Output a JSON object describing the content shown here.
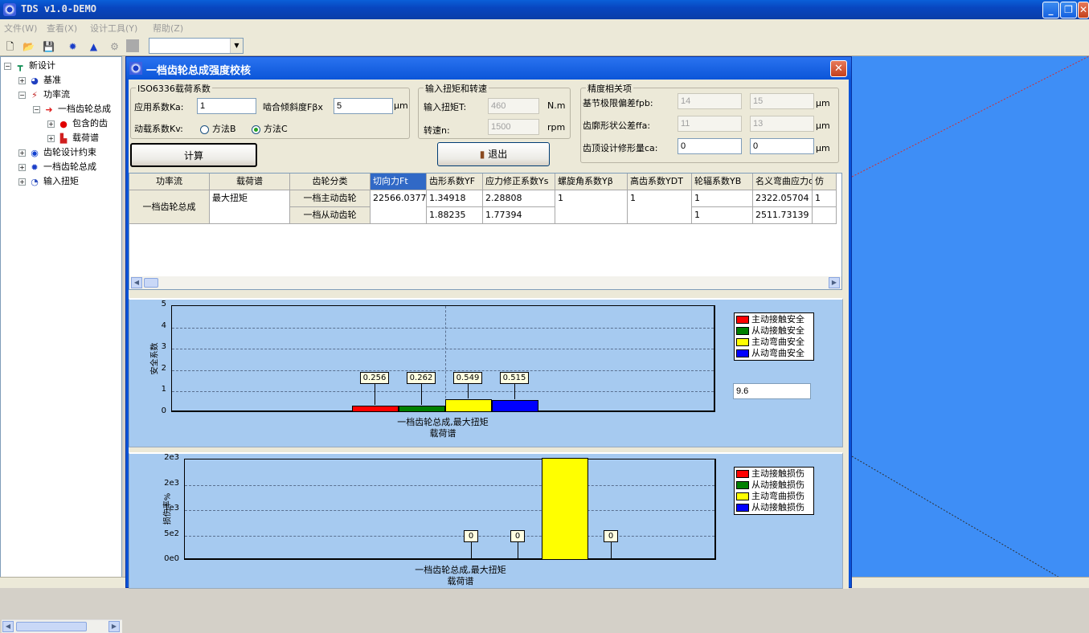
{
  "app": {
    "title": "TDS v1.0-DEMO"
  },
  "menu": [
    "文件(W)",
    "查看(X)",
    "设计工具(Y)",
    "帮助(Z)"
  ],
  "toolbar": {
    "combo_value": ""
  },
  "tree": {
    "items": [
      {
        "label": "新设计",
        "level": 0,
        "icon": "design-root-icon",
        "expander": "−"
      },
      {
        "label": "基准",
        "level": 1,
        "icon": "datum-icon",
        "expander": "+"
      },
      {
        "label": "功率流",
        "level": 1,
        "icon": "power-flow-icon",
        "expander": "−"
      },
      {
        "label": "一档齿轮总成",
        "level": 2,
        "icon": "arrow-red-icon",
        "expander": "−"
      },
      {
        "label": "包含的齿",
        "level": 3,
        "icon": "red-dot-icon",
        "expander": "+"
      },
      {
        "label": "载荷谱",
        "level": 3,
        "icon": "load-spectrum-icon",
        "expander": "+"
      },
      {
        "label": "齿轮设计约束",
        "level": 1,
        "icon": "constraint-icon",
        "expander": "+"
      },
      {
        "label": "一档齿轮总成",
        "level": 1,
        "icon": "gear-assembly-icon",
        "expander": "+"
      },
      {
        "label": "输入扭矩",
        "level": 1,
        "icon": "torque-icon",
        "expander": "+"
      }
    ]
  },
  "dialog": {
    "title": "一档齿轮总成强度校核",
    "iso": {
      "title": "ISO6336载荷系数",
      "ka_label": "应用系数Ka:",
      "ka_value": "1",
      "fbx_label": "啮合倾斜度Fβx",
      "fbx_value": "5",
      "fbx_unit": "μm",
      "kv_label": "动载系数Kv:",
      "method_b": "方法B",
      "method_c": "方法C",
      "selected": "C"
    },
    "torque": {
      "title": "输入扭矩和转速",
      "t_label": "输入扭矩T:",
      "t_value": "460",
      "t_unit": "N.m",
      "n_label": "转速n:",
      "n_value": "1500",
      "n_unit": "rpm"
    },
    "precision": {
      "title": "精度相关项",
      "fpb_label": "基节极限偏差fpb:",
      "fpb_1": "14",
      "fpb_2": "15",
      "fpb_unit": "μm",
      "ffa_label": "齿廓形状公差ffa:",
      "ffa_1": "11",
      "ffa_2": "13",
      "ffa_unit": "μm",
      "ca_label": "齿顶设计修形量ca:",
      "ca_1": "0",
      "ca_2": "0",
      "ca_unit": "μm"
    },
    "calc_button": "计算",
    "exit_button": "退出",
    "table": {
      "headers": [
        "功率流",
        "载荷谱",
        "齿轮分类",
        "切向力Ft",
        "齿形系数YF",
        "应力修正系数Ys",
        "螺旋角系数Yβ",
        "高齿系数YDT",
        "轮辐系数YB",
        "名义弯曲应力σF0",
        "仿"
      ],
      "powerflow": "一档齿轮总成",
      "spectrum": "最大扭矩",
      "rows": [
        {
          "gear": "一档主动齿轮",
          "ft": "22566.03774",
          "yf": "1.34918",
          "ys": "2.28808",
          "yb": "1",
          "ydt": "1",
          "yB": "1",
          "sf0": "2322.05704",
          "extra": "1"
        },
        {
          "gear": "一档从动齿轮",
          "ft": "",
          "yf": "1.88235",
          "ys": "1.77394",
          "yb": "",
          "ydt": "",
          "yB": "1",
          "sf0": "2511.73139",
          "extra": ""
        }
      ]
    },
    "chart1_side_value": "9.6"
  },
  "chart_data": [
    {
      "type": "bar",
      "ylabel": "安全系数",
      "xlabel": "载荷谱",
      "categories": [
        "一档齿轮总成,最大扭矩"
      ],
      "ylim": [
        0,
        5
      ],
      "yticks": [
        "0",
        "1",
        "2",
        "3",
        "4",
        "5"
      ],
      "series": [
        {
          "name": "主动接触安全",
          "values": [
            0.256
          ],
          "label": "0.256",
          "color": "#ff0000"
        },
        {
          "name": "从动接触安全",
          "values": [
            0.262
          ],
          "label": "0.262",
          "color": "#008000"
        },
        {
          "name": "主动弯曲安全",
          "values": [
            0.549
          ],
          "label": "0.549",
          "color": "#ffff00"
        },
        {
          "name": "从动弯曲安全",
          "values": [
            0.515
          ],
          "label": "0.515",
          "color": "#0000ff"
        }
      ]
    },
    {
      "type": "bar",
      "ylabel": "损伤率%",
      "xlabel": "载荷谱",
      "categories": [
        "一档齿轮总成,最大扭矩"
      ],
      "ylim": [
        0,
        2000
      ],
      "yticks": [
        "0e0",
        "5e2",
        "1e3",
        "2e3",
        "2e3"
      ],
      "series": [
        {
          "name": "主动接触损伤",
          "values": [
            0
          ],
          "label": "0",
          "color": "#ff0000"
        },
        {
          "name": "从动接触损伤",
          "values": [
            0
          ],
          "label": "0",
          "color": "#008000"
        },
        {
          "name": "主动弯曲损伤",
          "values": [
            2000
          ],
          "label": "",
          "color": "#ffff00"
        },
        {
          "name": "从动接触损伤",
          "values": [
            0
          ],
          "label": "0",
          "color": "#0000ff"
        }
      ]
    }
  ]
}
